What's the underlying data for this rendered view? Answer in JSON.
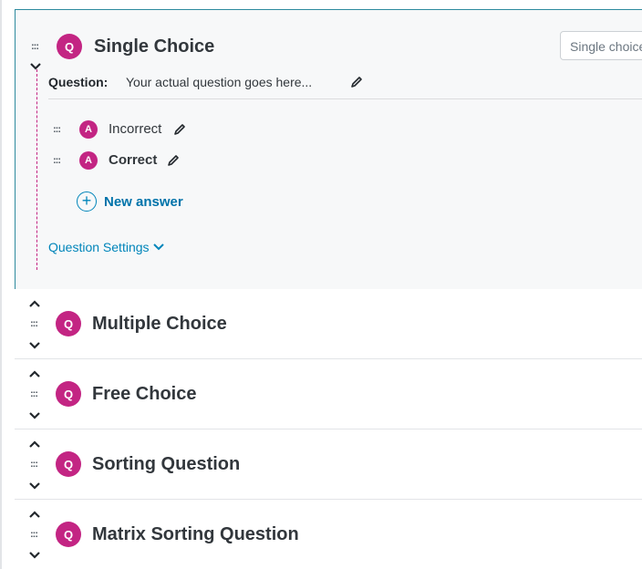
{
  "expanded_question": {
    "badge": "Q",
    "title": "Single Choice",
    "type_select_value": "Single choice",
    "question_label": "Question:",
    "question_text": "Your actual question goes here...",
    "answers": [
      {
        "badge": "A",
        "label": "Incorrect",
        "correct": false
      },
      {
        "badge": "A",
        "label": "Correct",
        "correct": true
      }
    ],
    "new_answer_label": "New answer",
    "settings_label": "Question Settings"
  },
  "collapsed_questions": [
    {
      "badge": "Q",
      "title": "Multiple Choice"
    },
    {
      "badge": "Q",
      "title": "Free Choice"
    },
    {
      "badge": "Q",
      "title": "Sorting Question"
    },
    {
      "badge": "Q",
      "title": "Matrix Sorting Question"
    }
  ],
  "colors": {
    "accent": "#c32583",
    "link": "#0085ba",
    "border_active": "#2d8a9e"
  },
  "icons": {
    "drag": "drag-handle-icon",
    "edit": "pencil-icon",
    "up": "chevron-up-icon",
    "down": "chevron-down-icon",
    "add": "plus-circle-icon"
  }
}
